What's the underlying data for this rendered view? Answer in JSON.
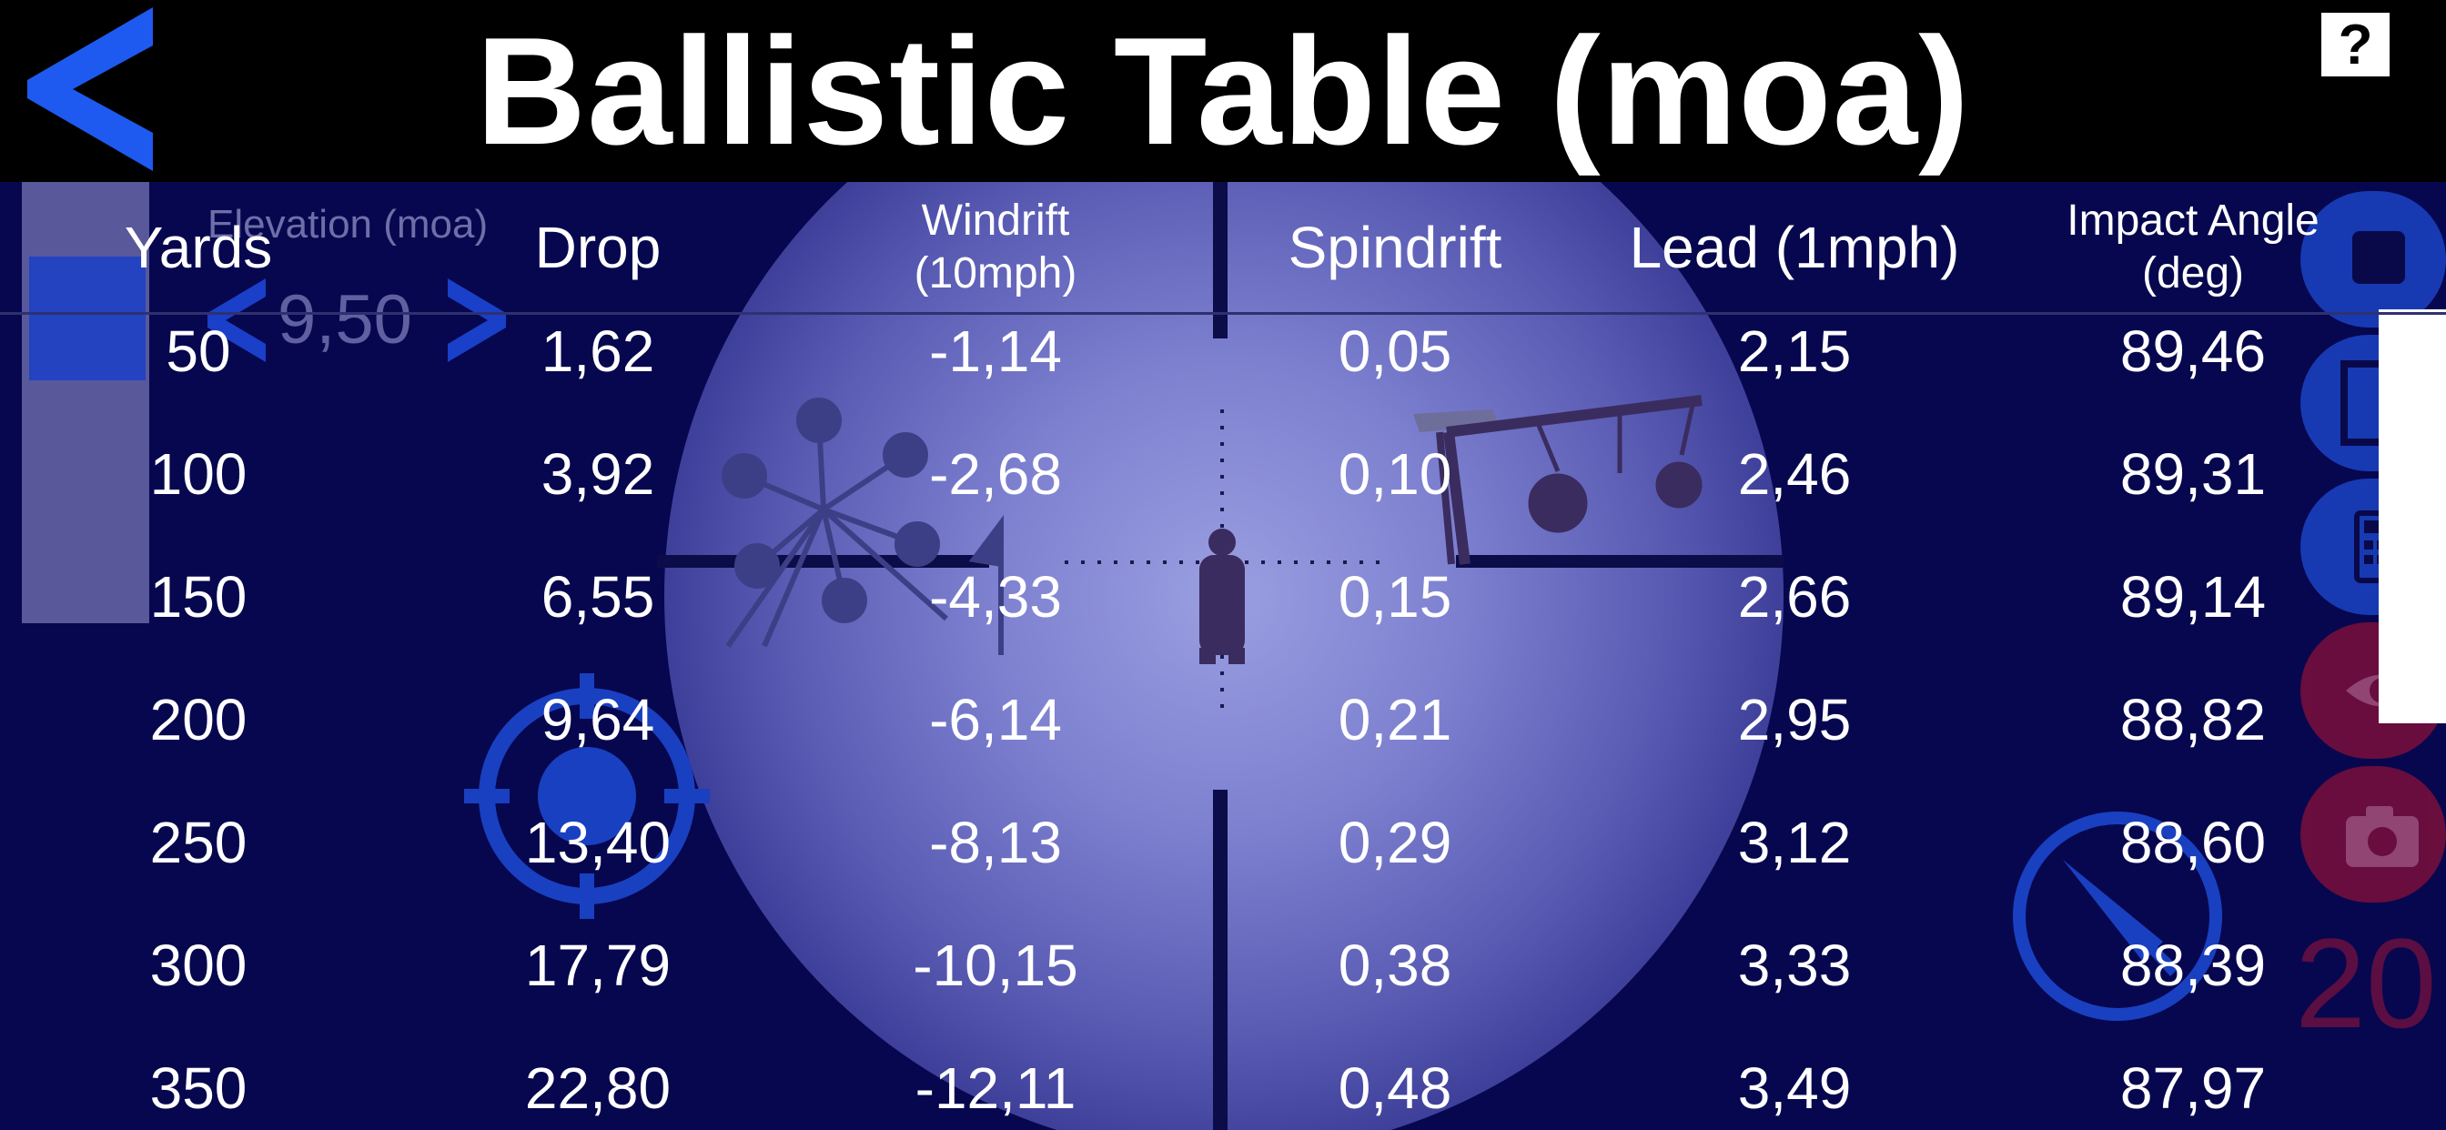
{
  "header": {
    "title": "Ballistic Table (moa)",
    "help_label": "?"
  },
  "elevation": {
    "label": "Elevation (moa)",
    "value": "9,50"
  },
  "side_number": "20",
  "table": {
    "columns": [
      "Yards",
      "Drop",
      "Windrift\n(10mph)",
      "Spindrift",
      "Lead (1mph)",
      "Impact Angle\n(deg)"
    ],
    "rows": [
      [
        "50",
        "1,62",
        "-1,14",
        "0,05",
        "2,15",
        "89,46"
      ],
      [
        "100",
        "3,92",
        "-2,68",
        "0,10",
        "2,46",
        "89,31"
      ],
      [
        "150",
        "6,55",
        "-4,33",
        "0,15",
        "2,66",
        "89,14"
      ],
      [
        "200",
        "9,64",
        "-6,14",
        "0,21",
        "2,95",
        "88,82"
      ],
      [
        "250",
        "13,40",
        "-8,13",
        "0,29",
        "3,12",
        "88,60"
      ],
      [
        "300",
        "17,79",
        "-10,15",
        "0,38",
        "3,33",
        "88,39"
      ],
      [
        "350",
        "22,80",
        "-12,11",
        "0,48",
        "3,49",
        "87,97"
      ]
    ]
  },
  "colors": {
    "accent_blue": "#1e5af0",
    "background_navy": "#07074f",
    "scope_center": "#9a9ee0",
    "header_bg": "#000000"
  },
  "icons": {
    "back": "chevron-left-icon",
    "help": "question-icon",
    "target": "crosshair-icon",
    "compass": "compass-icon",
    "side": [
      "stop-icon",
      "square-icon",
      "calculator-icon",
      "eye-icon",
      "camera-icon"
    ]
  }
}
